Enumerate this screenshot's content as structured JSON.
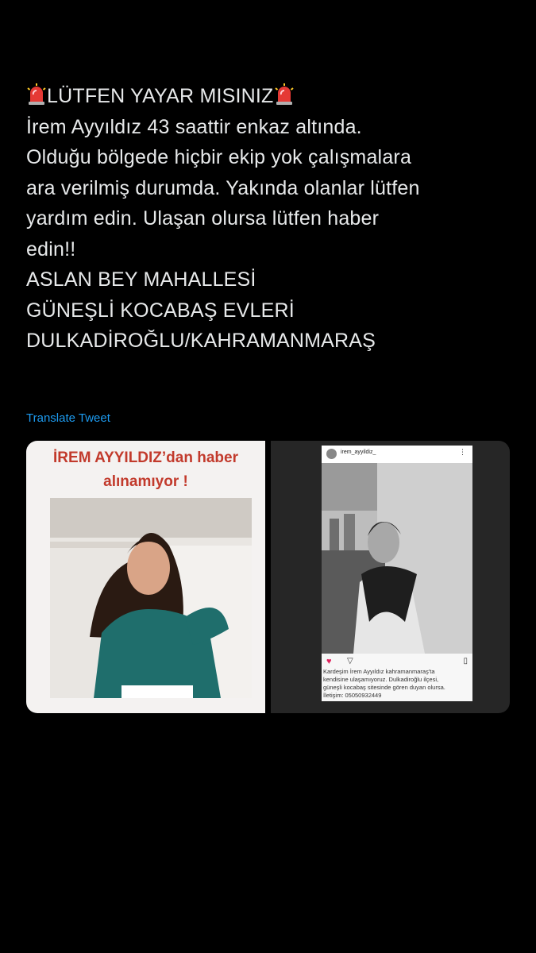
{
  "tweet": {
    "lines": [
      "LÜTFEN YAYAR MISINIZ",
      "İrem Ayyıldız 43 saattir enkaz altında.",
      "Olduğu bölgede hiçbir ekip yok çalışmalara",
      "ara verilmiş durumda. Yakında olanlar lütfen",
      "yardım edin. Ulaşan olursa lütfen haber",
      "edin!!",
      "ASLAN BEY MAHALLESİ",
      "GÜNEŞLİ KOCABAŞ EVLERİ",
      "DULKADİROĞLU/KAHRAMANMARAŞ"
    ],
    "emoji_icon": "police-siren-icon",
    "translate_label": "Translate Tweet"
  },
  "media": {
    "left_card": {
      "headline_line1": "İREM AYYILDIZ’dan haber",
      "headline_line2": "alınamıyor !"
    },
    "right_card": {
      "username": "irem_ayyildiz_",
      "caption_line1": "Kardeşim İrem Ayyıldız kahramanmaraş'ta",
      "caption_line2": "kendisine ulaşamıyoruz. Dulkadiroğlu ilçesi,",
      "caption_line3": "güneşli kocabaş sitesinde gören duyan olursa.",
      "caption_line4": "İletişim: 05050932449"
    }
  },
  "colors": {
    "background": "#000000",
    "text": "#e7e9ea",
    "link": "#1d9bf0",
    "headline_red": "#c23a2c"
  }
}
